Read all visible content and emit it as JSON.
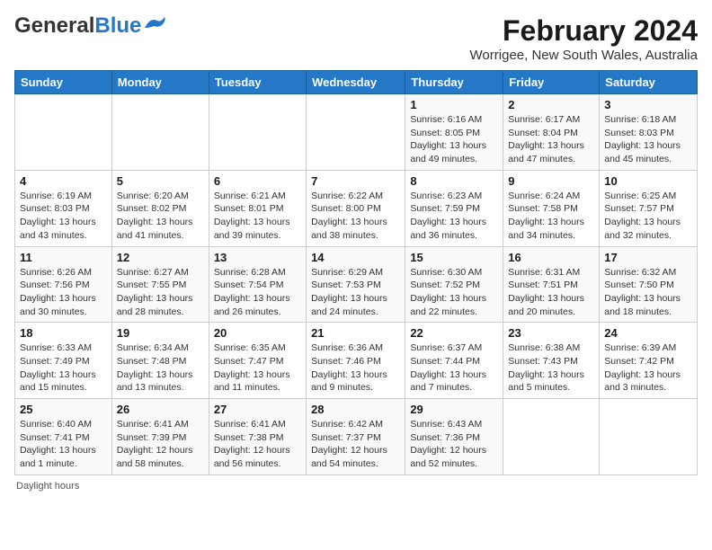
{
  "header": {
    "logo_general": "General",
    "logo_blue": "Blue",
    "title": "February 2024",
    "subtitle": "Worrigee, New South Wales, Australia"
  },
  "calendar": {
    "days_of_week": [
      "Sunday",
      "Monday",
      "Tuesday",
      "Wednesday",
      "Thursday",
      "Friday",
      "Saturday"
    ],
    "weeks": [
      [
        {
          "day": "",
          "info": ""
        },
        {
          "day": "",
          "info": ""
        },
        {
          "day": "",
          "info": ""
        },
        {
          "day": "",
          "info": ""
        },
        {
          "day": "1",
          "info": "Sunrise: 6:16 AM\nSunset: 8:05 PM\nDaylight: 13 hours\nand 49 minutes."
        },
        {
          "day": "2",
          "info": "Sunrise: 6:17 AM\nSunset: 8:04 PM\nDaylight: 13 hours\nand 47 minutes."
        },
        {
          "day": "3",
          "info": "Sunrise: 6:18 AM\nSunset: 8:03 PM\nDaylight: 13 hours\nand 45 minutes."
        }
      ],
      [
        {
          "day": "4",
          "info": "Sunrise: 6:19 AM\nSunset: 8:03 PM\nDaylight: 13 hours\nand 43 minutes."
        },
        {
          "day": "5",
          "info": "Sunrise: 6:20 AM\nSunset: 8:02 PM\nDaylight: 13 hours\nand 41 minutes."
        },
        {
          "day": "6",
          "info": "Sunrise: 6:21 AM\nSunset: 8:01 PM\nDaylight: 13 hours\nand 39 minutes."
        },
        {
          "day": "7",
          "info": "Sunrise: 6:22 AM\nSunset: 8:00 PM\nDaylight: 13 hours\nand 38 minutes."
        },
        {
          "day": "8",
          "info": "Sunrise: 6:23 AM\nSunset: 7:59 PM\nDaylight: 13 hours\nand 36 minutes."
        },
        {
          "day": "9",
          "info": "Sunrise: 6:24 AM\nSunset: 7:58 PM\nDaylight: 13 hours\nand 34 minutes."
        },
        {
          "day": "10",
          "info": "Sunrise: 6:25 AM\nSunset: 7:57 PM\nDaylight: 13 hours\nand 32 minutes."
        }
      ],
      [
        {
          "day": "11",
          "info": "Sunrise: 6:26 AM\nSunset: 7:56 PM\nDaylight: 13 hours\nand 30 minutes."
        },
        {
          "day": "12",
          "info": "Sunrise: 6:27 AM\nSunset: 7:55 PM\nDaylight: 13 hours\nand 28 minutes."
        },
        {
          "day": "13",
          "info": "Sunrise: 6:28 AM\nSunset: 7:54 PM\nDaylight: 13 hours\nand 26 minutes."
        },
        {
          "day": "14",
          "info": "Sunrise: 6:29 AM\nSunset: 7:53 PM\nDaylight: 13 hours\nand 24 minutes."
        },
        {
          "day": "15",
          "info": "Sunrise: 6:30 AM\nSunset: 7:52 PM\nDaylight: 13 hours\nand 22 minutes."
        },
        {
          "day": "16",
          "info": "Sunrise: 6:31 AM\nSunset: 7:51 PM\nDaylight: 13 hours\nand 20 minutes."
        },
        {
          "day": "17",
          "info": "Sunrise: 6:32 AM\nSunset: 7:50 PM\nDaylight: 13 hours\nand 18 minutes."
        }
      ],
      [
        {
          "day": "18",
          "info": "Sunrise: 6:33 AM\nSunset: 7:49 PM\nDaylight: 13 hours\nand 15 minutes."
        },
        {
          "day": "19",
          "info": "Sunrise: 6:34 AM\nSunset: 7:48 PM\nDaylight: 13 hours\nand 13 minutes."
        },
        {
          "day": "20",
          "info": "Sunrise: 6:35 AM\nSunset: 7:47 PM\nDaylight: 13 hours\nand 11 minutes."
        },
        {
          "day": "21",
          "info": "Sunrise: 6:36 AM\nSunset: 7:46 PM\nDaylight: 13 hours\nand 9 minutes."
        },
        {
          "day": "22",
          "info": "Sunrise: 6:37 AM\nSunset: 7:44 PM\nDaylight: 13 hours\nand 7 minutes."
        },
        {
          "day": "23",
          "info": "Sunrise: 6:38 AM\nSunset: 7:43 PM\nDaylight: 13 hours\nand 5 minutes."
        },
        {
          "day": "24",
          "info": "Sunrise: 6:39 AM\nSunset: 7:42 PM\nDaylight: 13 hours\nand 3 minutes."
        }
      ],
      [
        {
          "day": "25",
          "info": "Sunrise: 6:40 AM\nSunset: 7:41 PM\nDaylight: 13 hours\nand 1 minute."
        },
        {
          "day": "26",
          "info": "Sunrise: 6:41 AM\nSunset: 7:39 PM\nDaylight: 12 hours\nand 58 minutes."
        },
        {
          "day": "27",
          "info": "Sunrise: 6:41 AM\nSunset: 7:38 PM\nDaylight: 12 hours\nand 56 minutes."
        },
        {
          "day": "28",
          "info": "Sunrise: 6:42 AM\nSunset: 7:37 PM\nDaylight: 12 hours\nand 54 minutes."
        },
        {
          "day": "29",
          "info": "Sunrise: 6:43 AM\nSunset: 7:36 PM\nDaylight: 12 hours\nand 52 minutes."
        },
        {
          "day": "",
          "info": ""
        },
        {
          "day": "",
          "info": ""
        }
      ]
    ]
  },
  "footer": {
    "text": "Daylight hours"
  },
  "colors": {
    "header_bg": "#2577c8",
    "logo_blue": "#2577c8"
  }
}
